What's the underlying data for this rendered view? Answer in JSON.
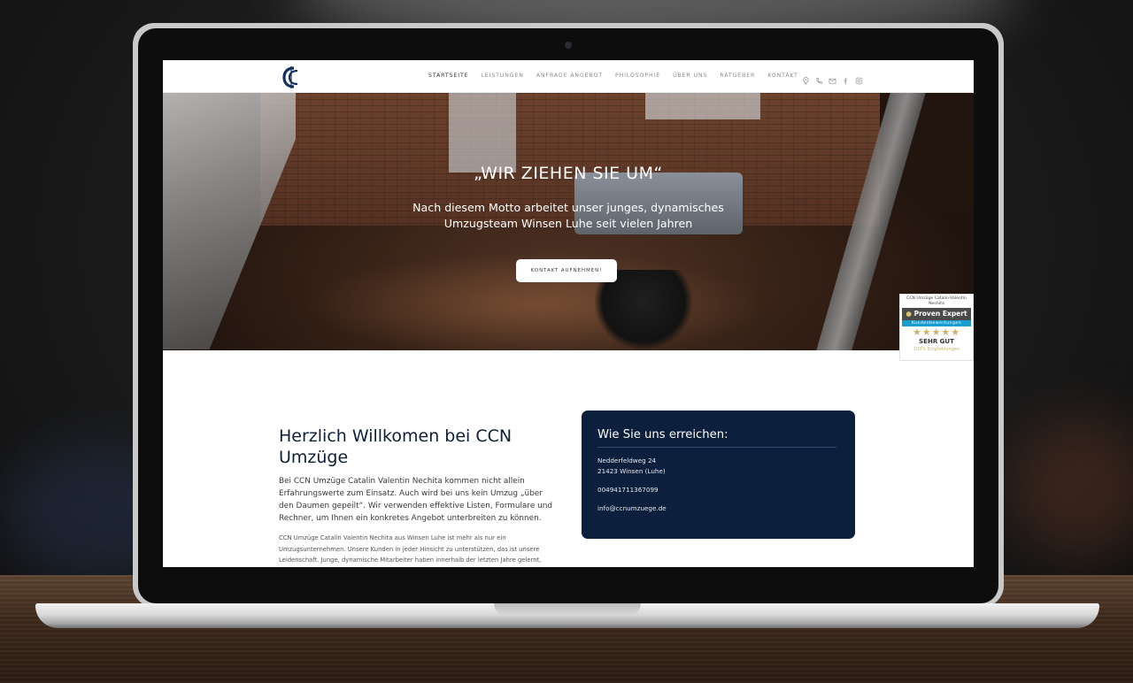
{
  "nav": {
    "items": [
      {
        "label": "STARTSEITE",
        "active": true
      },
      {
        "label": "LEISTUNGEN",
        "active": false
      },
      {
        "label": "ANFRAGE ANGEBOT",
        "active": false
      },
      {
        "label": "PHILOSOPHIE",
        "active": false
      },
      {
        "label": "ÜBER UNS",
        "active": false
      },
      {
        "label": "RATGEBER",
        "active": false
      },
      {
        "label": "KONTAKT",
        "active": false
      }
    ],
    "icons": [
      "map-pin-icon",
      "phone-icon",
      "mail-icon",
      "facebook-icon",
      "instagram-icon"
    ]
  },
  "hero": {
    "title": "„WIR ZIEHEN SIE UM“",
    "subtitle": "Nach diesem Motto arbeitet unser junges, dynamisches Umzugsteam Winsen Luhe seit vielen Jahren",
    "button_label": "KONTAKT AUFNEHMEN!"
  },
  "badge": {
    "name": "CCN Umzüge Catalin-Valentin Nechita",
    "logo_text": "Proven Expert",
    "sub": "Kundenbewertungen",
    "stars": "★★★★★",
    "grade": "SEHR GUT",
    "recommendation": "100% Empfehlungen"
  },
  "welcome": {
    "title": "Herzlich Willkomen bei CCN Umzüge",
    "paragraph1": "Bei CCN Umzüge Catalin Valentin Nechita kommen nicht allein Erfahrungswerte zum Einsatz. Auch wird bei uns kein Umzug „über den Daumen gepeilt“. Wir verwenden effektive Listen, Formulare und Rechner, um Ihnen ein konkretes Angebot unterbreiten zu können.",
    "paragraph2": "CCN Umzüge Catalin Valentin Nechita aus Winsen Luhe ist mehr als nur ein Umzugsunternehmen. Unsere Kunden in jeder Hinsicht zu unterstützen, das ist unsere Leidenschaft. Junge, dynamische Mitarbeiter haben innerhalb der letzten Jahre gelernt,"
  },
  "contact": {
    "title": "Wie Sie uns erreichen:",
    "street": "Nedderfeldweg 24",
    "city": "21423 Winsen (Luhe)",
    "phone": "004941711367099",
    "email": "info@ccnumzuege.de"
  },
  "colors": {
    "navy": "#0c1f3c",
    "gold": "#c9b36a",
    "proven_blue": "#1b9ccf"
  }
}
